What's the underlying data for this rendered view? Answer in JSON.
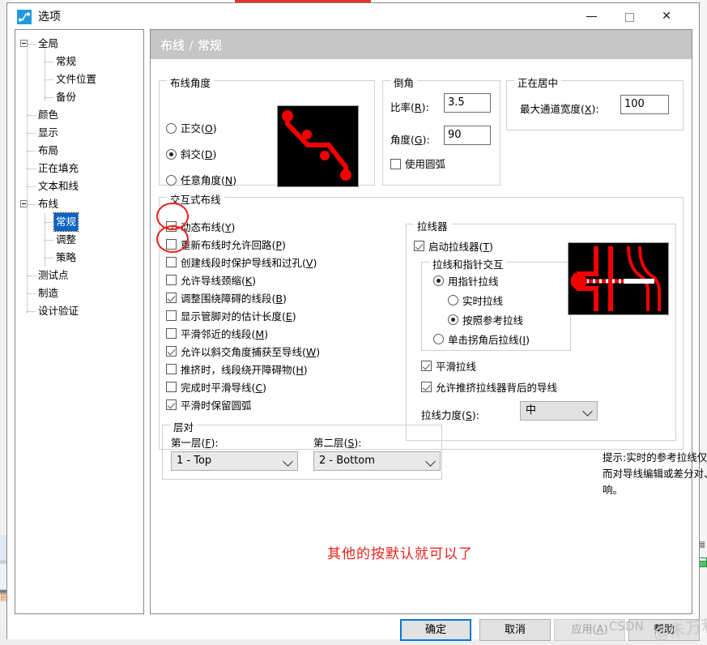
{
  "window": {
    "title": "选项",
    "icon": "route-icon",
    "minimize": "—",
    "maximize": "□",
    "close": "✕"
  },
  "tree": {
    "items": [
      {
        "label": "全局",
        "indent": 0,
        "expander": "collapse",
        "selected": false
      },
      {
        "label": "常规",
        "indent": 1,
        "expander": "none",
        "selected": false
      },
      {
        "label": "文件位置",
        "indent": 1,
        "expander": "none",
        "selected": false
      },
      {
        "label": "备份",
        "indent": 1,
        "expander": "none",
        "selected": false
      },
      {
        "label": "颜色",
        "indent": 0,
        "expander": "none",
        "selected": false
      },
      {
        "label": "显示",
        "indent": 0,
        "expander": "none",
        "selected": false
      },
      {
        "label": "布局",
        "indent": 0,
        "expander": "none",
        "selected": false
      },
      {
        "label": "正在填充",
        "indent": 0,
        "expander": "none",
        "selected": false
      },
      {
        "label": "文本和线",
        "indent": 0,
        "expander": "none",
        "selected": false
      },
      {
        "label": "布线",
        "indent": 0,
        "expander": "collapse",
        "selected": false
      },
      {
        "label": "常规",
        "indent": 1,
        "expander": "none",
        "selected": true
      },
      {
        "label": "调整",
        "indent": 1,
        "expander": "none",
        "selected": false
      },
      {
        "label": "策略",
        "indent": 1,
        "expander": "none",
        "selected": false
      },
      {
        "label": "测试点",
        "indent": 0,
        "expander": "none",
        "selected": false
      },
      {
        "label": "制造",
        "indent": 0,
        "expander": "none",
        "selected": false
      },
      {
        "label": "设计验证",
        "indent": 0,
        "expander": "none",
        "selected": false
      }
    ]
  },
  "page": {
    "header": "布线 / 常规"
  },
  "route_angle": {
    "legend": "布线角度",
    "options": [
      {
        "label": "正交(O)",
        "mnemonic": "O",
        "selected": false
      },
      {
        "label": "斜交(D)",
        "mnemonic": "D",
        "selected": true
      },
      {
        "label": "任意角度(N)",
        "mnemonic": "N",
        "selected": false
      }
    ],
    "preview": "diagonal-route-preview"
  },
  "chamfer": {
    "legend": "倒角",
    "ratio_label": "比率(R):",
    "ratio_value": "3.5",
    "angle_label": "角度(G):",
    "angle_value": "90",
    "arc_checkbox": {
      "label": "使用圆弧",
      "checked": false
    }
  },
  "centering": {
    "legend": "正在居中",
    "max_width_label": "最大通道宽度(X):",
    "max_width_value": "100"
  },
  "interactive": {
    "legend": "交互式布线",
    "items": [
      {
        "label": "动态布线(Y)",
        "checked": true,
        "annotated": true
      },
      {
        "label": "重新布线时允许回路(P)",
        "checked": false,
        "annotated": true
      },
      {
        "label": "创建线段时保护导线和过孔(V)",
        "checked": false,
        "annotated": false
      },
      {
        "label": "允许导线颈缩(K)",
        "checked": false,
        "annotated": false
      },
      {
        "label": "调整围绕障碍的线段(B)",
        "checked": true,
        "annotated": false
      },
      {
        "label": "显示管脚对的估计长度(E)",
        "checked": false,
        "annotated": false
      },
      {
        "label": "平滑邻近的线段(M)",
        "checked": false,
        "annotated": false
      },
      {
        "label": "允许以斜交角度捕获至导线(W)",
        "checked": true,
        "annotated": false
      },
      {
        "label": "推挤时，线段绕开障碍物(H)",
        "checked": false,
        "annotated": false
      },
      {
        "label": "完成时平滑导线(C)",
        "checked": false,
        "annotated": false
      },
      {
        "label": "平滑时保留圆弧",
        "checked": true,
        "annotated": false
      }
    ]
  },
  "puller": {
    "legend": "拉线器",
    "enable": {
      "label": "启动拉线器(T)",
      "checked": true
    },
    "subgroup": {
      "legend": "拉线和指针交互",
      "options": [
        {
          "label": "用指针拉线",
          "selected": true,
          "level": 0
        },
        {
          "label": "实时拉线",
          "selected": false,
          "level": 1
        },
        {
          "label": "按照参考拉线",
          "selected": true,
          "level": 1
        },
        {
          "label": "单击拐角后拉线(I)",
          "selected": false,
          "level": 0
        }
      ]
    },
    "smooth": {
      "label": "平滑拉线",
      "checked": true
    },
    "push": {
      "label": "允许推挤拉线器背后的导线",
      "checked": true
    },
    "strength_label": "拉线力度(S):",
    "strength_value": "中",
    "preview": "puller-preview"
  },
  "layer_pair": {
    "legend": "层对",
    "first_label": "第一层(F):",
    "first_value": "1 - Top",
    "second_label": "第二层(S):",
    "second_value": "2 - Bottom"
  },
  "hint": "提示:实时的参考拉线仅对交互式布线操作有影响，而对导线编辑或差分对、圆弧或蛇形走线布线没有影响。",
  "annotation_note": "其他的按默认就可以了",
  "footer": {
    "ok": "确定",
    "cancel": "取消",
    "apply": "应用(A)",
    "help": "帮助",
    "apply_disabled": true
  },
  "watermark": {
    "left": "CSDN",
    "right": "@朱万利"
  },
  "colors": {
    "accent_red": "#e8231d",
    "selection_blue": "#0a64c8",
    "header_gray": "#c6c6c6",
    "default_button_border": "#0078d7"
  }
}
